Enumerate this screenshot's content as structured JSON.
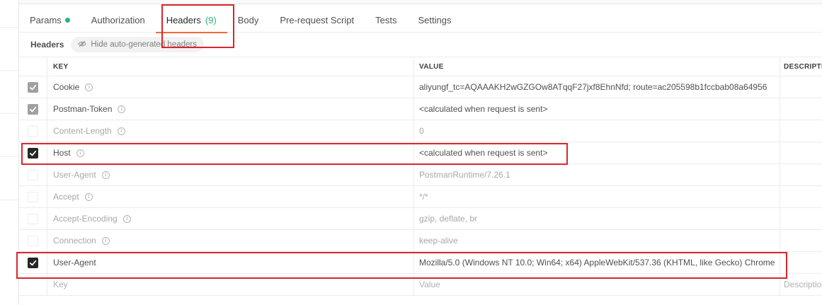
{
  "tabs": [
    {
      "label": "Params",
      "dot": true
    },
    {
      "label": "Authorization"
    },
    {
      "label": "Headers",
      "count": "(9)",
      "active": true
    },
    {
      "label": "Body"
    },
    {
      "label": "Pre-request Script"
    },
    {
      "label": "Tests"
    },
    {
      "label": "Settings"
    }
  ],
  "subbar": {
    "title": "Headers",
    "hide_label": "Hide auto-generated headers"
  },
  "table": {
    "columns": {
      "key": "KEY",
      "value": "VALUE",
      "description": "DESCRIPTION"
    },
    "rows": [
      {
        "key": "Cookie",
        "value": "aliyungf_tc=AQAAAKH2wGZGOw8ATqqF27jxf8EhnNfd; route=ac205598b1fccbab08a64956",
        "state": "checked-gray",
        "info": true,
        "disabled": false
      },
      {
        "key": "Postman-Token",
        "value": "<calculated when request is sent>",
        "state": "checked-gray",
        "info": true,
        "disabled": false
      },
      {
        "key": "Content-Length",
        "value": "0",
        "state": "unchecked",
        "info": true,
        "disabled": true
      },
      {
        "key": "Host",
        "value": "<calculated when request is sent>",
        "state": "checked-dark",
        "info": true,
        "disabled": false
      },
      {
        "key": "User-Agent",
        "value": "PostmanRuntime/7.26.1",
        "state": "unchecked",
        "info": true,
        "disabled": true
      },
      {
        "key": "Accept",
        "value": "*/*",
        "state": "unchecked",
        "info": true,
        "disabled": true
      },
      {
        "key": "Accept-Encoding",
        "value": "gzip, deflate, br",
        "state": "unchecked",
        "info": true,
        "disabled": true
      },
      {
        "key": "Connection",
        "value": "keep-alive",
        "state": "unchecked",
        "info": true,
        "disabled": true
      },
      {
        "key": "User-Agent",
        "value": "Mozilla/5.0 (Windows NT 10.0; Win64; x64) AppleWebKit/537.36 (KHTML, like Gecko) Chrome",
        "state": "checked-dark",
        "info": false,
        "disabled": false
      }
    ],
    "new_row": {
      "key_placeholder": "Key",
      "value_placeholder": "Value",
      "description_placeholder": "Description"
    }
  },
  "icons": {
    "info": "info-icon",
    "eye_off": "eye-off-icon",
    "check": "check-icon"
  },
  "colors": {
    "accent": "#f26b3a",
    "success": "#26b47f",
    "annotation": "#d9262c"
  }
}
